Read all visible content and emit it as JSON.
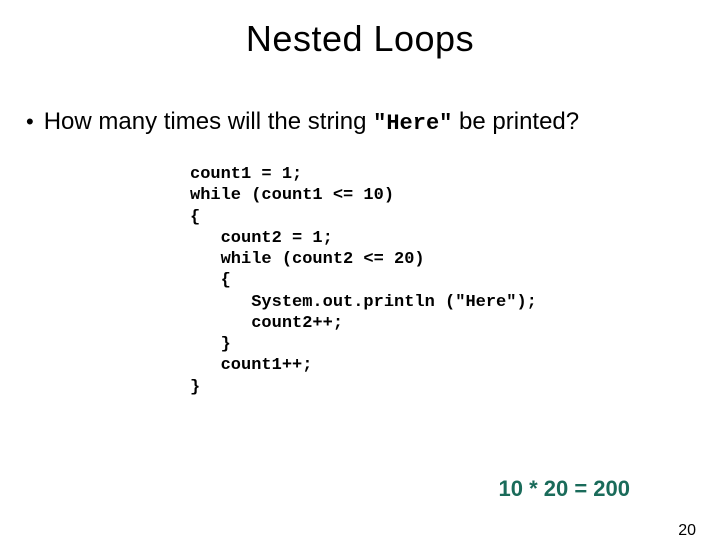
{
  "title": "Nested Loops",
  "bullet": {
    "pre": "How many times will the string ",
    "code": "\"Here\"",
    "post": " be printed?"
  },
  "code": "count1 = 1;\nwhile (count1 <= 10)\n{\n   count2 = 1;\n   while (count2 <= 20)\n   {\n      System.out.println (\"Here\");\n      count2++;\n   }\n   count1++;\n}",
  "answer": "10 * 20 = 200",
  "page_number": "20"
}
